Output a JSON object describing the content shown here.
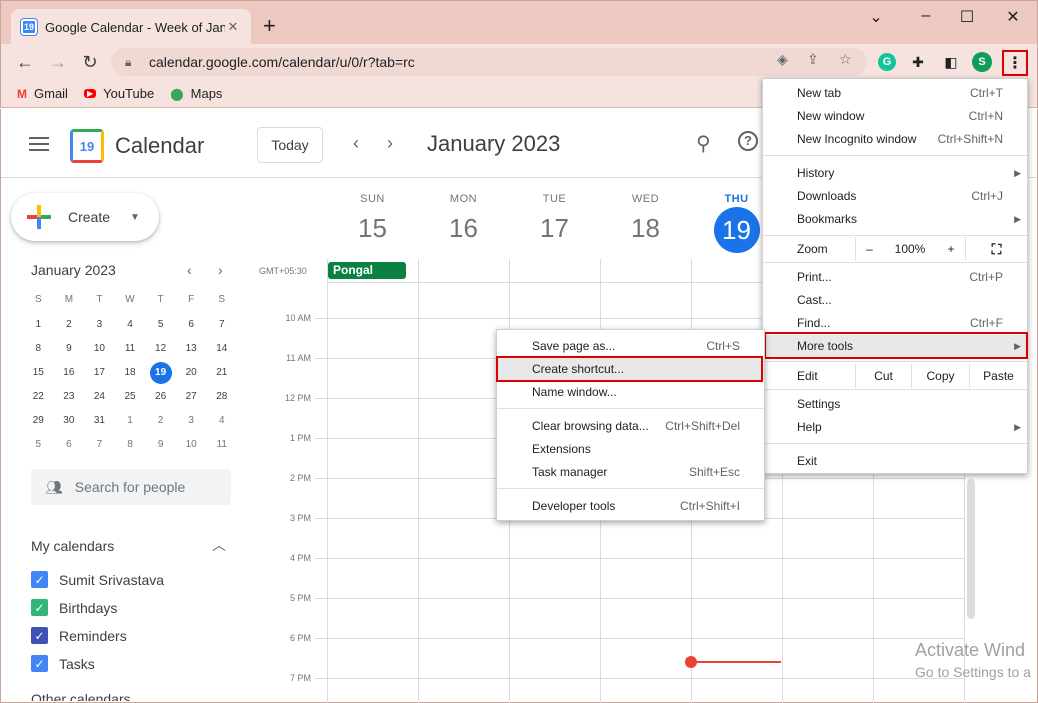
{
  "browser": {
    "tab_title": "Google Calendar - Week of Janu",
    "tab_icon_text": "19",
    "url": "calendar.google.com/calendar/u/0/r?tab=rc",
    "profile_initial": "S",
    "bookmarks": [
      {
        "label": "Gmail",
        "icon": "gmail-icon"
      },
      {
        "label": "YouTube",
        "icon": "youtube-icon"
      },
      {
        "label": "Maps",
        "icon": "maps-icon"
      }
    ]
  },
  "calendar": {
    "app_name": "Calendar",
    "logo_text": "19",
    "today_label": "Today",
    "month_title": "January 2023",
    "create_label": "Create",
    "timezone": "GMT+05:30",
    "days": [
      {
        "name": "SUN",
        "date": "15"
      },
      {
        "name": "MON",
        "date": "16"
      },
      {
        "name": "TUE",
        "date": "17"
      },
      {
        "name": "WED",
        "date": "18"
      },
      {
        "name": "THU",
        "date": "19"
      }
    ],
    "event_allday": "Pongal",
    "hours": [
      "10 AM",
      "11 AM",
      "12 PM",
      "1 PM",
      "2 PM",
      "3 PM",
      "4 PM",
      "5 PM",
      "6 PM",
      "7 PM"
    ]
  },
  "mini_calendar": {
    "month": "January 2023",
    "weekdays": [
      "S",
      "M",
      "T",
      "W",
      "T",
      "F",
      "S"
    ],
    "weeks": [
      [
        "1",
        "2",
        "3",
        "4",
        "5",
        "6",
        "7"
      ],
      [
        "8",
        "9",
        "10",
        "11",
        "12",
        "13",
        "14"
      ],
      [
        "15",
        "16",
        "17",
        "18",
        "19",
        "20",
        "21"
      ],
      [
        "22",
        "23",
        "24",
        "25",
        "26",
        "27",
        "28"
      ],
      [
        "29",
        "30",
        "31",
        "1",
        "2",
        "3",
        "4"
      ],
      [
        "5",
        "6",
        "7",
        "8",
        "9",
        "10",
        "11"
      ]
    ],
    "selected": "19"
  },
  "sidebar": {
    "search_people": "Search for people",
    "my_calendars_title": "My calendars",
    "calendars": [
      {
        "name": "Sumit Srivastava",
        "color": "#4285f4"
      },
      {
        "name": "Birthdays",
        "color": "#33b679"
      },
      {
        "name": "Reminders",
        "color": "#3f51b5"
      },
      {
        "name": "Tasks",
        "color": "#4285f4"
      }
    ],
    "other_calendars_title": "Other calendars"
  },
  "chrome_menu": {
    "new_tab": {
      "label": "New tab",
      "shortcut": "Ctrl+T"
    },
    "new_window": {
      "label": "New window",
      "shortcut": "Ctrl+N"
    },
    "new_incognito": {
      "label": "New Incognito window",
      "shortcut": "Ctrl+Shift+N"
    },
    "history": {
      "label": "History"
    },
    "downloads": {
      "label": "Downloads",
      "shortcut": "Ctrl+J"
    },
    "bookmarks": {
      "label": "Bookmarks"
    },
    "zoom": {
      "label": "Zoom",
      "minus": "–",
      "value": "100%",
      "plus": "+"
    },
    "print": {
      "label": "Print...",
      "shortcut": "Ctrl+P"
    },
    "cast": {
      "label": "Cast..."
    },
    "find": {
      "label": "Find...",
      "shortcut": "Ctrl+F"
    },
    "more_tools": {
      "label": "More tools"
    },
    "edit": {
      "label": "Edit",
      "cut": "Cut",
      "copy": "Copy",
      "paste": "Paste"
    },
    "settings": {
      "label": "Settings"
    },
    "help": {
      "label": "Help"
    },
    "exit": {
      "label": "Exit"
    }
  },
  "more_tools_menu": {
    "save_page": {
      "label": "Save page as...",
      "shortcut": "Ctrl+S"
    },
    "create_shortcut": {
      "label": "Create shortcut..."
    },
    "name_window": {
      "label": "Name window..."
    },
    "clear_browsing": {
      "label": "Clear browsing data...",
      "shortcut": "Ctrl+Shift+Del"
    },
    "extensions": {
      "label": "Extensions"
    },
    "task_manager": {
      "label": "Task manager",
      "shortcut": "Shift+Esc"
    },
    "developer_tools": {
      "label": "Developer tools",
      "shortcut": "Ctrl+Shift+I"
    }
  },
  "watermark": {
    "line1": "Activate Wind",
    "line2": "Go to Settings to a"
  }
}
